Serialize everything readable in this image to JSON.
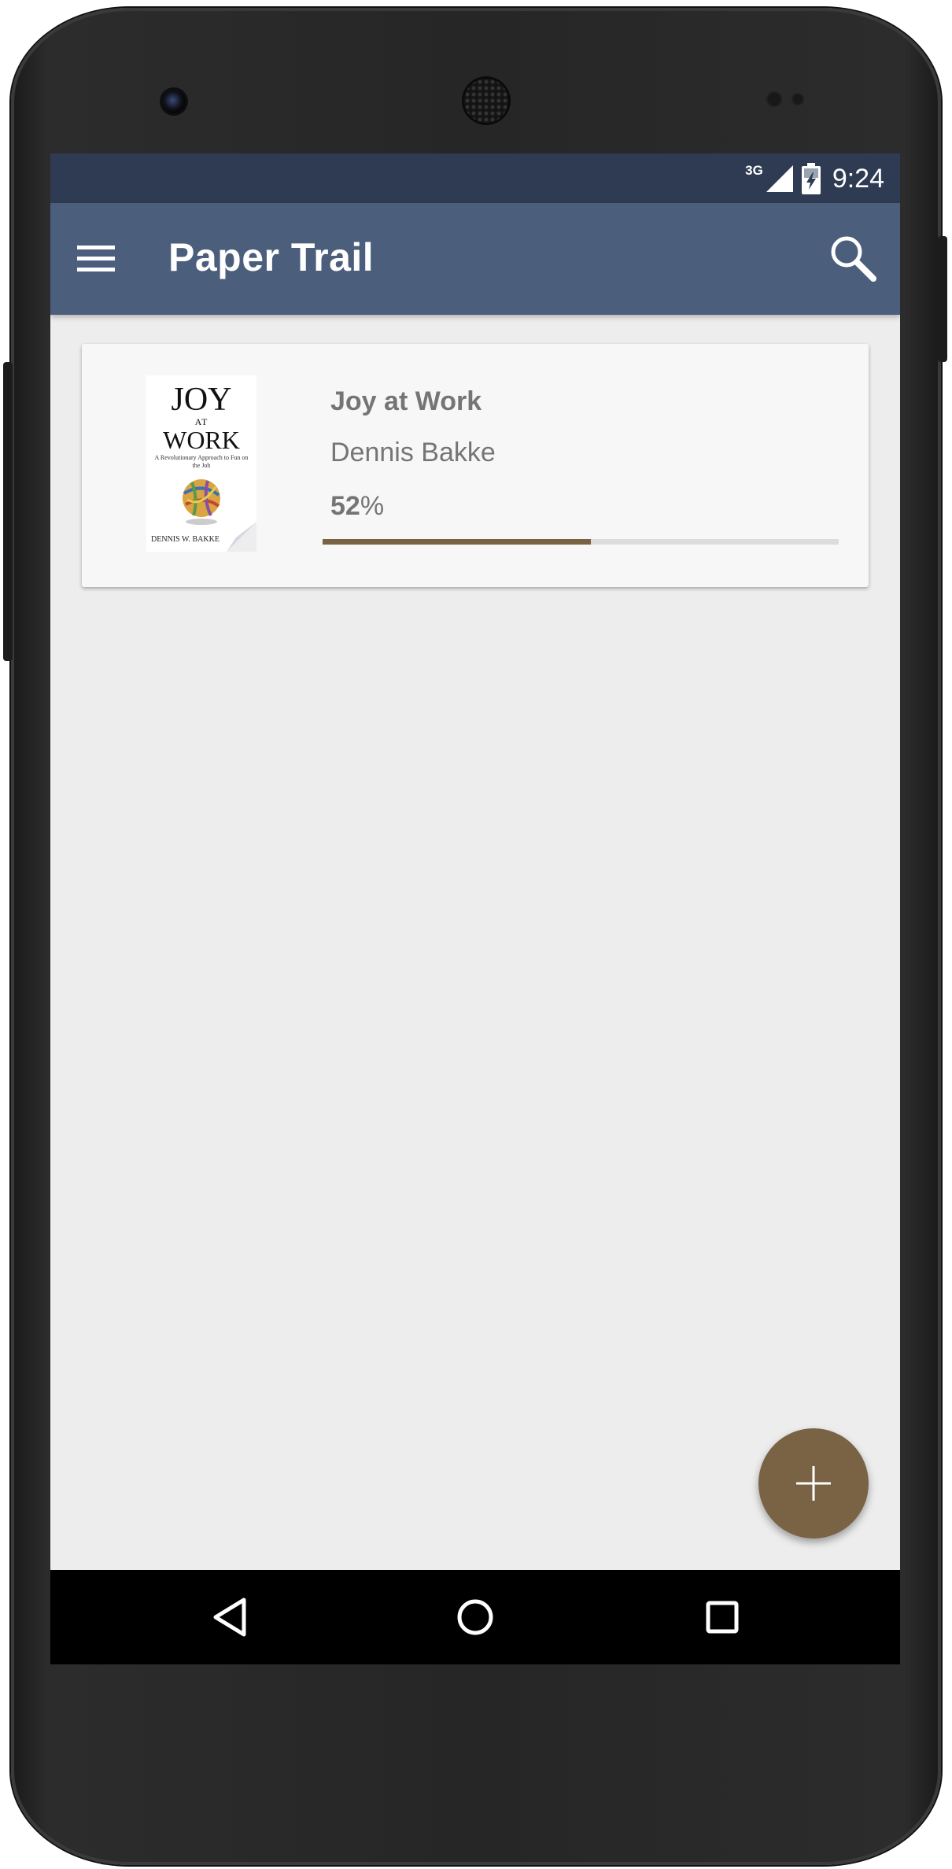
{
  "status_bar": {
    "network": "3G",
    "time": "9:24"
  },
  "app_bar": {
    "title": "Paper Trail",
    "menu_icon": "hamburger-menu-icon",
    "search_icon": "search-icon"
  },
  "books": [
    {
      "title": "Joy at Work",
      "author": "Dennis Bakke",
      "progress_number": "52",
      "progress_unit": "%",
      "progress_fraction": 0.52,
      "cover": {
        "title_line1": "JOY",
        "title_line2": "AT",
        "title_line3": "WORK",
        "subtitle": "A Revolutionary Approach to Fun on the Job",
        "author": "DENNIS W. BAKKE"
      }
    }
  ],
  "fab": {
    "icon": "add-icon"
  },
  "nav_bar": {
    "back_icon": "back-triangle-icon",
    "home_icon": "home-circle-icon",
    "recents_icon": "recents-square-icon"
  },
  "colors": {
    "status_bar": "#2e3b53",
    "app_bar": "#4b5e7c",
    "accent": "#7a6244",
    "background": "#ededed",
    "card": "#f7f7f7"
  }
}
